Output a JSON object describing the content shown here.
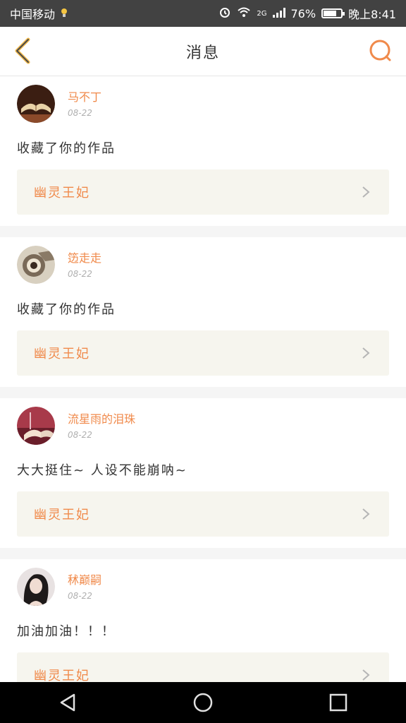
{
  "status_bar": {
    "carrier": "中国移动",
    "network": "2G",
    "battery": "76%",
    "battery_level": 0.76,
    "time": "晚上8:41"
  },
  "header": {
    "title": "消息"
  },
  "colors": {
    "accent": "#f08a4b",
    "card_link_bg": "#f6f5ee",
    "divider": "#f5f5f5"
  },
  "messages": [
    {
      "username": "马不丁",
      "date": "08-22",
      "text": "收藏了你的作品",
      "work_title": "幽灵王妃",
      "avatar_icon": "book-avatar"
    },
    {
      "username": "笾走走",
      "date": "08-22",
      "text": "收藏了你的作品",
      "work_title": "幽灵王妃",
      "avatar_icon": "scroll-avatar"
    },
    {
      "username": "流星雨的泪珠",
      "date": "08-22",
      "text": "大大挺住~ 人设不能崩呐~",
      "work_title": "幽灵王妃",
      "avatar_icon": "reading-avatar"
    },
    {
      "username": "秫巅嗣",
      "date": "08-22",
      "text": "加油加油！！！",
      "work_title": "幽灵王妃",
      "avatar_icon": "portrait-avatar"
    }
  ]
}
